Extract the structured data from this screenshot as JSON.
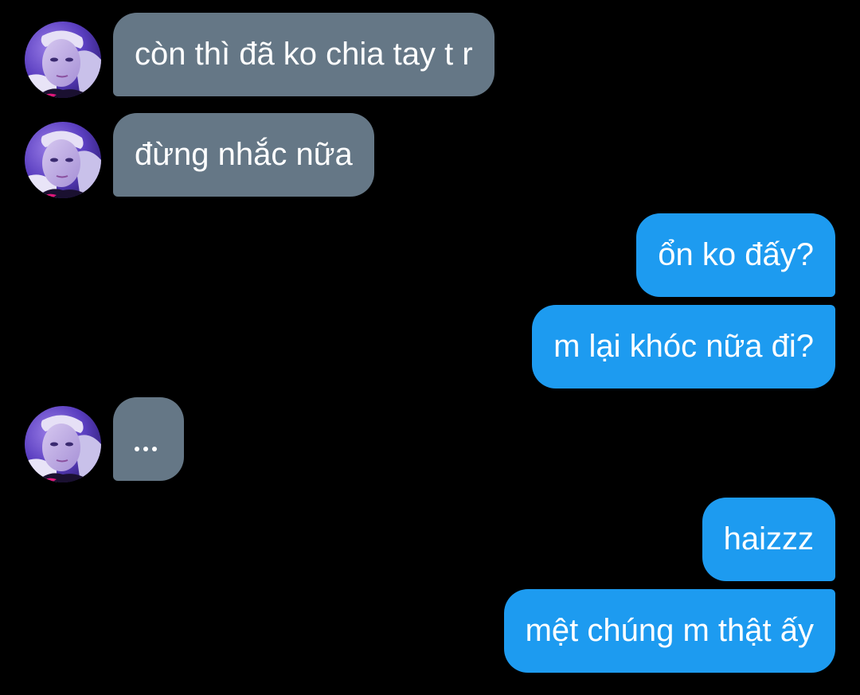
{
  "conversation": {
    "messages": [
      {
        "sender": "other",
        "text": "còn thì đã ko chia tay t r"
      },
      {
        "sender": "other",
        "text": "đừng nhắc nữa"
      },
      {
        "sender": "me",
        "text": "ổn ko đấy?"
      },
      {
        "sender": "me",
        "text": "m lại khóc nữa đi?"
      },
      {
        "sender": "other",
        "text": "..."
      },
      {
        "sender": "me",
        "text": "haizzz"
      },
      {
        "sender": "me",
        "text": "mệt chúng m thật ấy"
      }
    ]
  },
  "colors": {
    "background": "#000000",
    "incoming_bubble": "#657786",
    "outgoing_bubble": "#1d9bf0",
    "text": "#ffffff"
  },
  "icons": {
    "avatar": "user-avatar-photo"
  }
}
